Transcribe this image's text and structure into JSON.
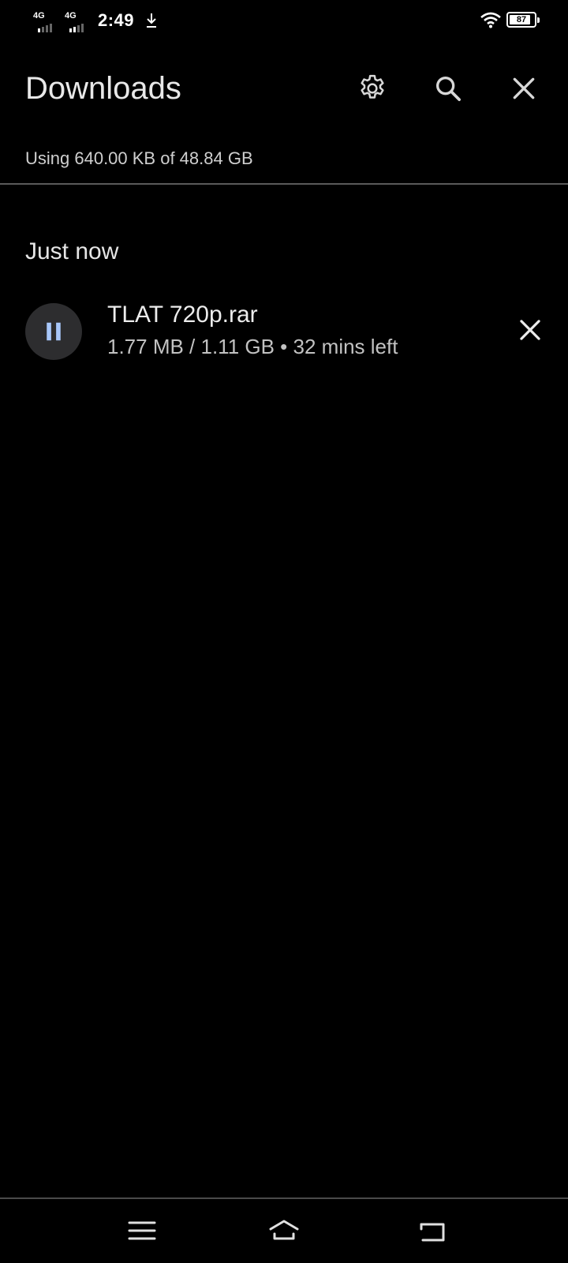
{
  "status_bar": {
    "network_1": "4G",
    "network_2": "4G",
    "time": "2:49",
    "battery_percent": "87",
    "battery_level": 0.87,
    "icons": [
      "download-icon",
      "wifi-icon",
      "battery-icon"
    ]
  },
  "header": {
    "title": "Downloads",
    "icons": [
      "gear-icon",
      "search-icon",
      "close-icon"
    ]
  },
  "storage_text": "Using 640.00 KB of 48.84 GB",
  "sections": [
    {
      "label": "Just now",
      "items": [
        {
          "name": "TLAT 720p.rar",
          "status": "1.77 MB / 1.11 GB • 32 mins left",
          "action_icon": "pause-icon",
          "remove_icon": "close-icon"
        }
      ]
    }
  ],
  "colors": {
    "background": "#000000",
    "accent": "#a8c7fa",
    "pause_button_bg": "#2d2d2f"
  },
  "nav_bar": {
    "icons": [
      "menu-icon",
      "home-icon",
      "back-icon"
    ]
  }
}
